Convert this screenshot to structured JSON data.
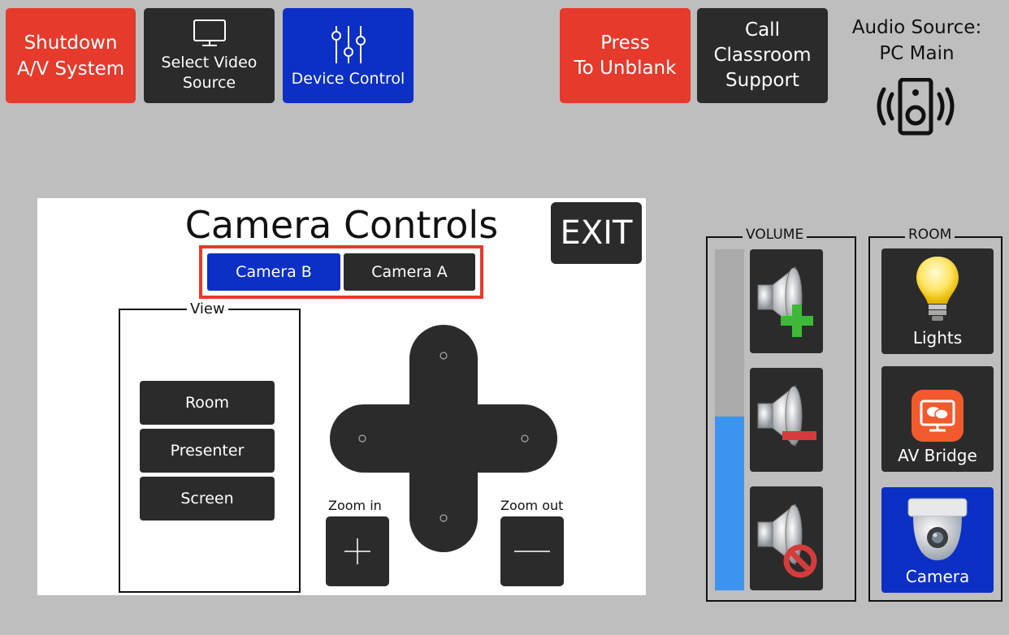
{
  "top_bar": {
    "shutdown": [
      "Shutdown",
      "A/V System"
    ],
    "select_video": [
      "Select Video",
      "Source"
    ],
    "device_control": "Device Control",
    "unblank": [
      "Press",
      "To Unblank"
    ],
    "support": [
      "Call",
      "Classroom",
      "Support"
    ]
  },
  "audio_source": {
    "label": "Audio Source:",
    "value": "PC Main"
  },
  "camera_panel": {
    "title": "Camera Controls",
    "exit": "EXIT",
    "camera_b": "Camera B",
    "camera_a": "Camera A",
    "view_legend": "View",
    "view_room": "Room",
    "view_presenter": "Presenter",
    "view_screen": "Screen",
    "zoom_in": "Zoom in",
    "zoom_out": "Zoom out"
  },
  "volume": {
    "legend": "VOLUME",
    "level_fraction": 0.51
  },
  "room": {
    "legend": "ROOM",
    "lights": "Lights",
    "av_bridge": "AV Bridge",
    "camera": "Camera"
  },
  "colors": {
    "background": "#bebebe",
    "red": "#e53a2c",
    "dark": "#2b2b2b",
    "blue": "#0c2fc5",
    "volume_fill": "#3d93f0"
  }
}
